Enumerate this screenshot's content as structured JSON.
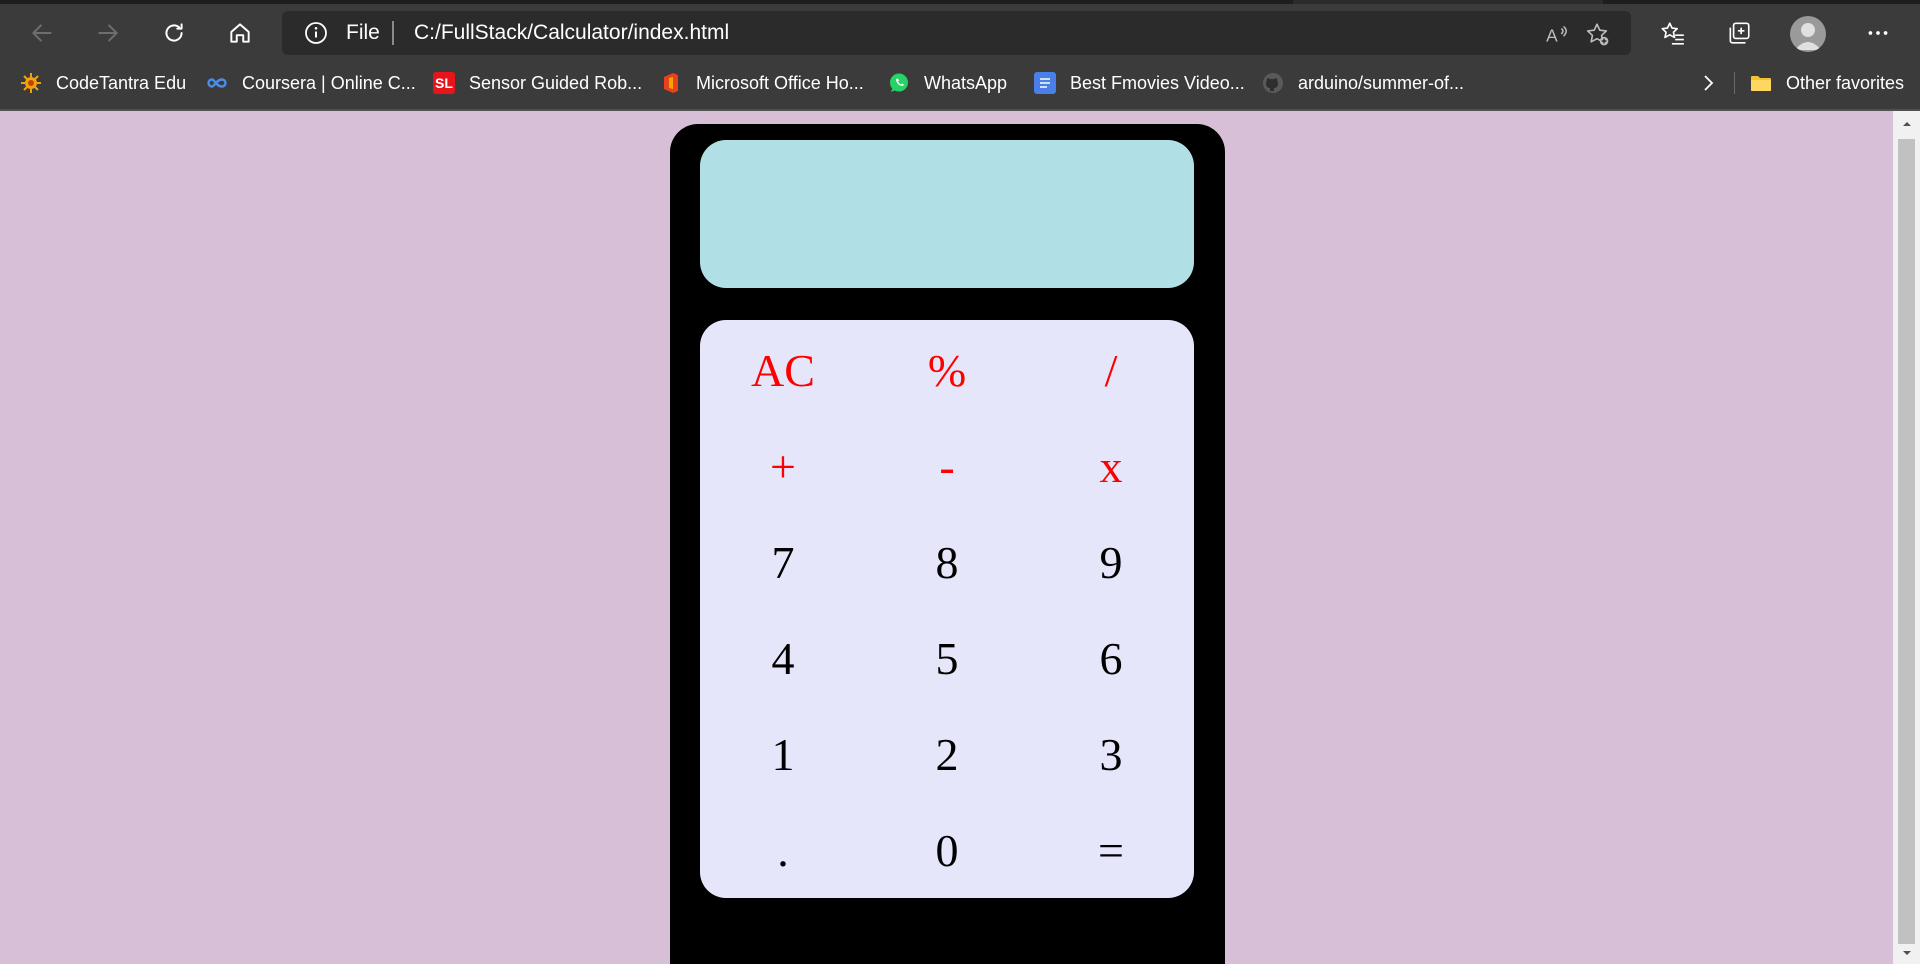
{
  "browser": {
    "address_scheme": "File",
    "address_url": "C:/FullStack/Calculator/index.html",
    "bookmarks": [
      {
        "label": "CodeTantra Edu",
        "icon": "codetantra-icon"
      },
      {
        "label": "Coursera | Online C...",
        "icon": "coursera-icon"
      },
      {
        "label": "Sensor Guided Rob...",
        "icon": "sl-icon",
        "icon_text": "SL"
      },
      {
        "label": "Microsoft Office Ho...",
        "icon": "office-icon"
      },
      {
        "label": "WhatsApp",
        "icon": "whatsapp-icon"
      },
      {
        "label": "Best Fmovies Video...",
        "icon": "document-icon"
      },
      {
        "label": "arduino/summer-of...",
        "icon": "github-icon"
      }
    ],
    "other_favorites": "Other favorites"
  },
  "calculator": {
    "display_value": "",
    "keys": [
      [
        "AC",
        "%",
        "/"
      ],
      [
        "+",
        "-",
        "x"
      ],
      [
        "7",
        "8",
        "9"
      ],
      [
        "4",
        "5",
        "6"
      ],
      [
        "1",
        "2",
        "3"
      ],
      [
        ".",
        "0",
        "="
      ]
    ]
  },
  "colors": {
    "page_background": "#d8bfd8",
    "calculator_body": "#000000",
    "display": "#b0e0e6",
    "keypad": "#e6e6fa",
    "operator_text": "#ff0000",
    "number_text": "#000000"
  }
}
